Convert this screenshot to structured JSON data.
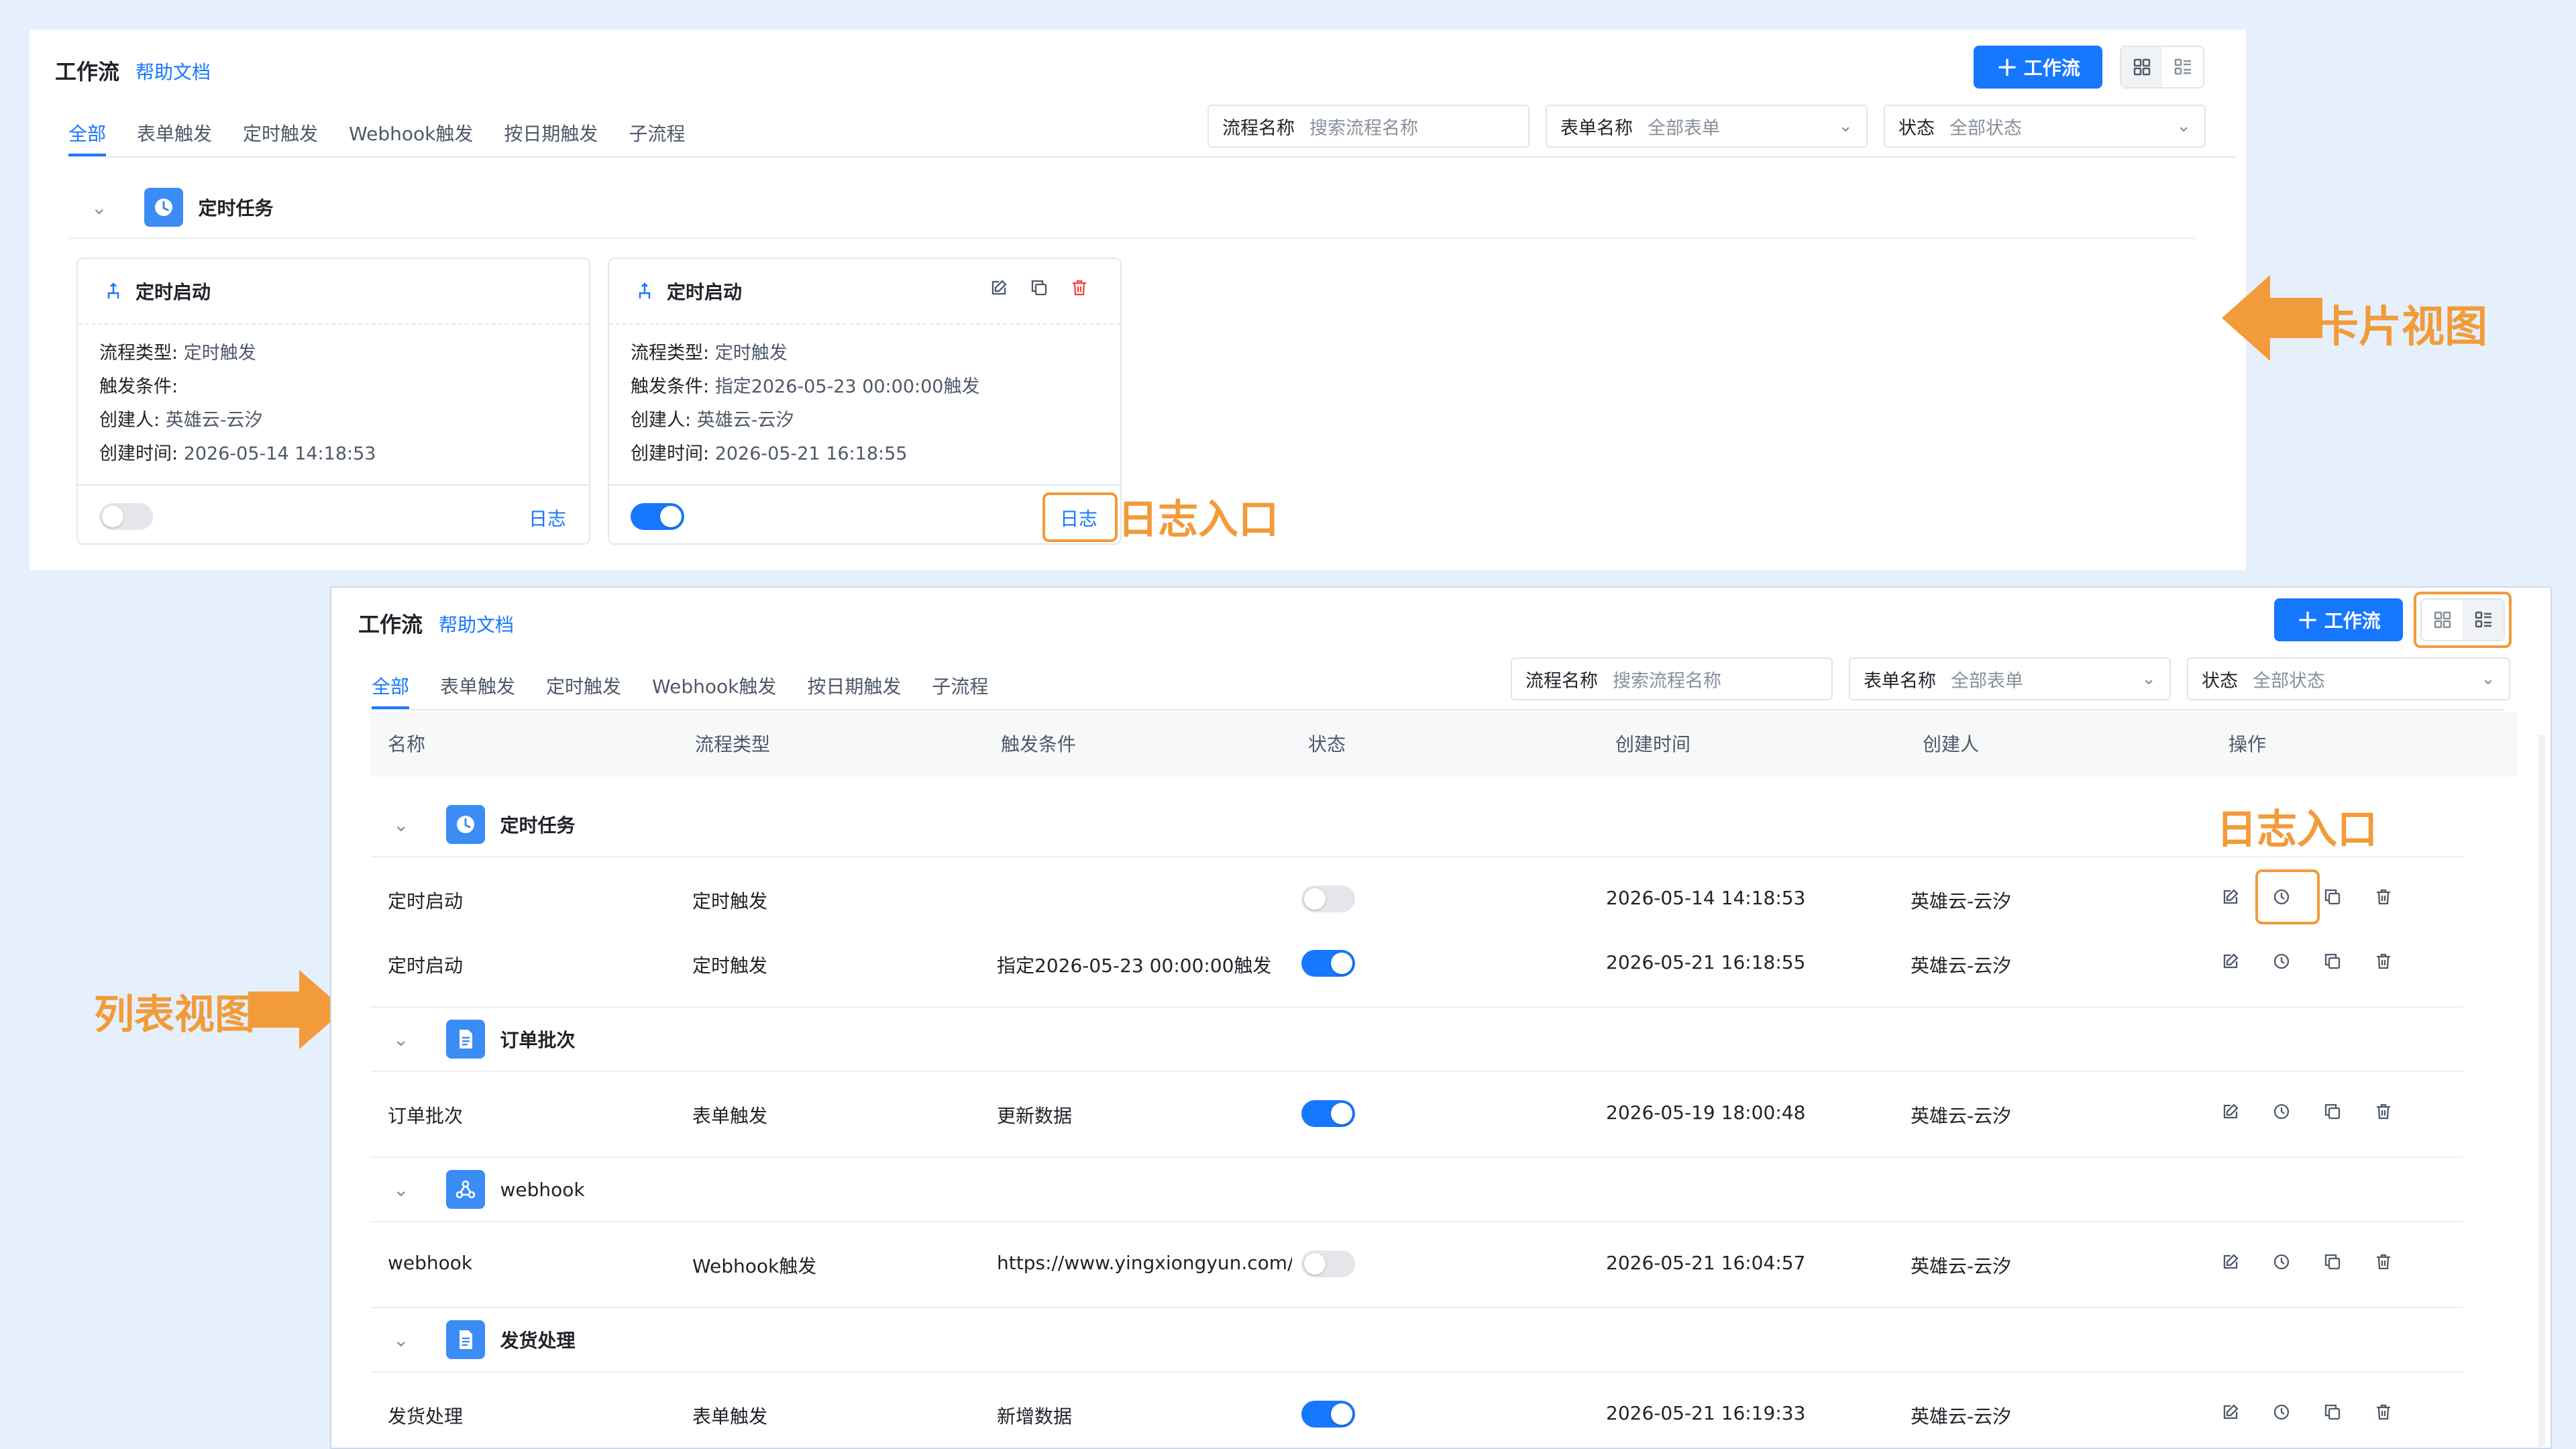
{
  "card_view": {
    "title": "工作流",
    "help": "帮助文档",
    "add_button": "工作流",
    "tabs": [
      "全部",
      "表单触发",
      "定时触发",
      "Webhook触发",
      "按日期触发",
      "子流程"
    ],
    "filters": {
      "flow_label": "流程名称",
      "flow_placeholder": "搜索流程名称",
      "form_label": "表单名称",
      "form_value": "全部表单",
      "status_label": "状态",
      "status_value": "全部状态"
    },
    "group": "定时任务",
    "cards": [
      {
        "title": "定时启动",
        "type_label": "流程类型:",
        "type": "定时触发",
        "cond_label": "触发条件:",
        "cond": "",
        "creator_label": "创建人:",
        "creator": "英雄云-云汐",
        "time_label": "创建时间:",
        "time": "2026-05-14 14:18:53",
        "enabled": false,
        "log": "日志"
      },
      {
        "title": "定时启动",
        "type_label": "流程类型:",
        "type": "定时触发",
        "cond_label": "触发条件:",
        "cond": "指定2026-05-23 00:00:00触发",
        "creator_label": "创建人:",
        "creator": "英雄云-云汐",
        "time_label": "创建时间:",
        "time": "2026-05-21 16:18:55",
        "enabled": true,
        "log": "日志"
      }
    ]
  },
  "annotations": {
    "card_view": "卡片视图",
    "log_entry": "日志入口",
    "list_view": "列表视图",
    "color": "#f29b3a"
  },
  "list_view": {
    "title": "工作流",
    "help": "帮助文档",
    "add_button": "工作流",
    "tabs": [
      "全部",
      "表单触发",
      "定时触发",
      "Webhook触发",
      "按日期触发",
      "子流程"
    ],
    "filters": {
      "flow_label": "流程名称",
      "flow_placeholder": "搜索流程名称",
      "form_label": "表单名称",
      "form_value": "全部表单",
      "status_label": "状态",
      "status_value": "全部状态"
    },
    "columns": [
      "名称",
      "流程类型",
      "触发条件",
      "状态",
      "创建时间",
      "创建人",
      "操作"
    ],
    "groups": [
      {
        "name": "定时任务",
        "icon": "clock-icon",
        "rows": [
          {
            "name": "定时启动",
            "type": "定时触发",
            "cond": "",
            "enabled": false,
            "time": "2026-05-14 14:18:53",
            "creator": "英雄云-云汐"
          },
          {
            "name": "定时启动",
            "type": "定时触发",
            "cond": "指定2026-05-23 00:00:00触发",
            "enabled": true,
            "time": "2026-05-21 16:18:55",
            "creator": "英雄云-云汐"
          }
        ]
      },
      {
        "name": "订单批次",
        "icon": "document-icon",
        "rows": [
          {
            "name": "订单批次",
            "type": "表单触发",
            "cond": "更新数据",
            "enabled": true,
            "time": "2026-05-19 18:00:48",
            "creator": "英雄云-云汐"
          }
        ]
      },
      {
        "name": "webhook",
        "icon": "webhook-icon",
        "rows": [
          {
            "name": "webhook",
            "type": "Webhook触发",
            "cond": "https://www.yingxiongyun.com/wo",
            "enabled": false,
            "time": "2026-05-21 16:04:57",
            "creator": "英雄云-云汐"
          }
        ]
      },
      {
        "name": "发货处理",
        "icon": "document-icon",
        "rows": [
          {
            "name": "发货处理",
            "type": "表单触发",
            "cond": "新增数据",
            "enabled": true,
            "time": "2026-05-21 16:19:33",
            "creator": "英雄云-云汐"
          }
        ]
      }
    ]
  }
}
